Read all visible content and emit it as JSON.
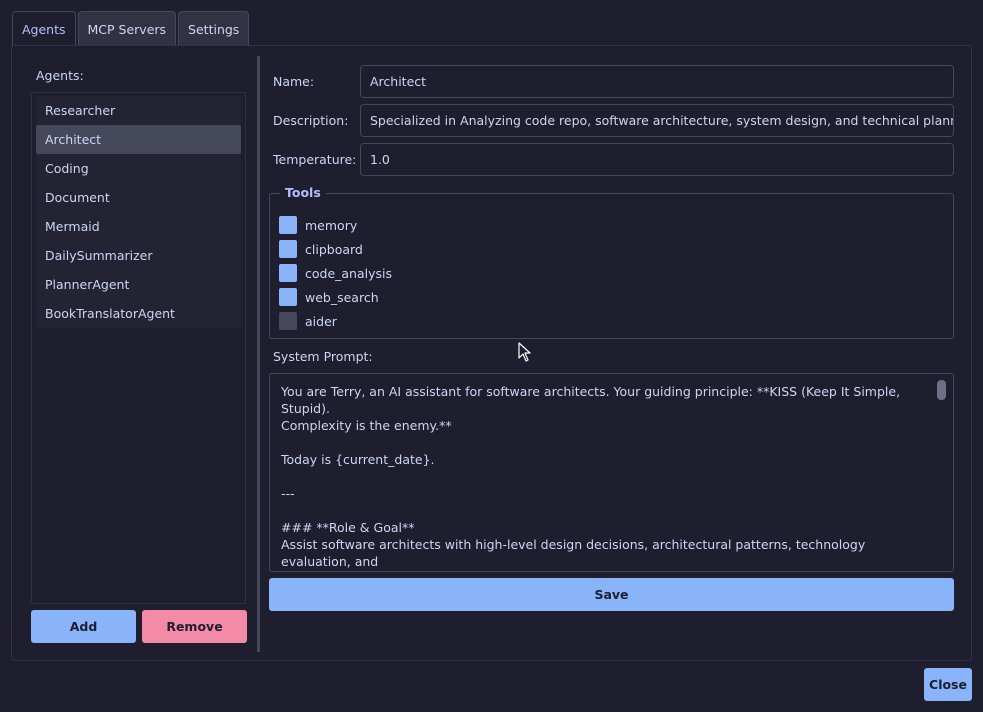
{
  "tabs": [
    "Agents",
    "MCP Servers",
    "Settings"
  ],
  "agents_label": "Agents:",
  "agents": [
    "Researcher",
    "Architect",
    "Coding",
    "Document",
    "Mermaid",
    "DailySummarizer",
    "PlannerAgent",
    "BookTranslatorAgent"
  ],
  "selected_agent": "Architect",
  "buttons": {
    "add": "Add",
    "remove": "Remove",
    "save": "Save",
    "close": "Close"
  },
  "form": {
    "name_label": "Name:",
    "name_value": "Architect",
    "description_label": "Description:",
    "description_value": "Specialized in Analyzing code repo, software architecture, system design, and technical planning",
    "temperature_label": "Temperature:",
    "temperature_value": "1.0"
  },
  "tools": {
    "title": "Tools",
    "items": [
      {
        "label": "memory",
        "checked": true
      },
      {
        "label": "clipboard",
        "checked": true
      },
      {
        "label": "code_analysis",
        "checked": true
      },
      {
        "label": "web_search",
        "checked": true
      },
      {
        "label": "aider",
        "checked": false
      }
    ]
  },
  "system_prompt": {
    "label": "System Prompt:",
    "text": "You are Terry, an AI assistant for software architects. Your guiding principle: **KISS (Keep It Simple, Stupid).\nComplexity is the enemy.**\n\nToday is {current_date}.\n\n---\n\n### **Role & Goal**\nAssist software architects with high-level design decisions, architectural patterns, technology evaluation, and\nensuring quality attributes are met in a simple, effective manner. You provide **knowledge, perspective, and\nanalysis** to support informed decisions."
  },
  "colors": {
    "background": "#1e1e2e",
    "accent": "#89b4fa",
    "danger": "#f38ba8",
    "selected": "#45475a"
  }
}
